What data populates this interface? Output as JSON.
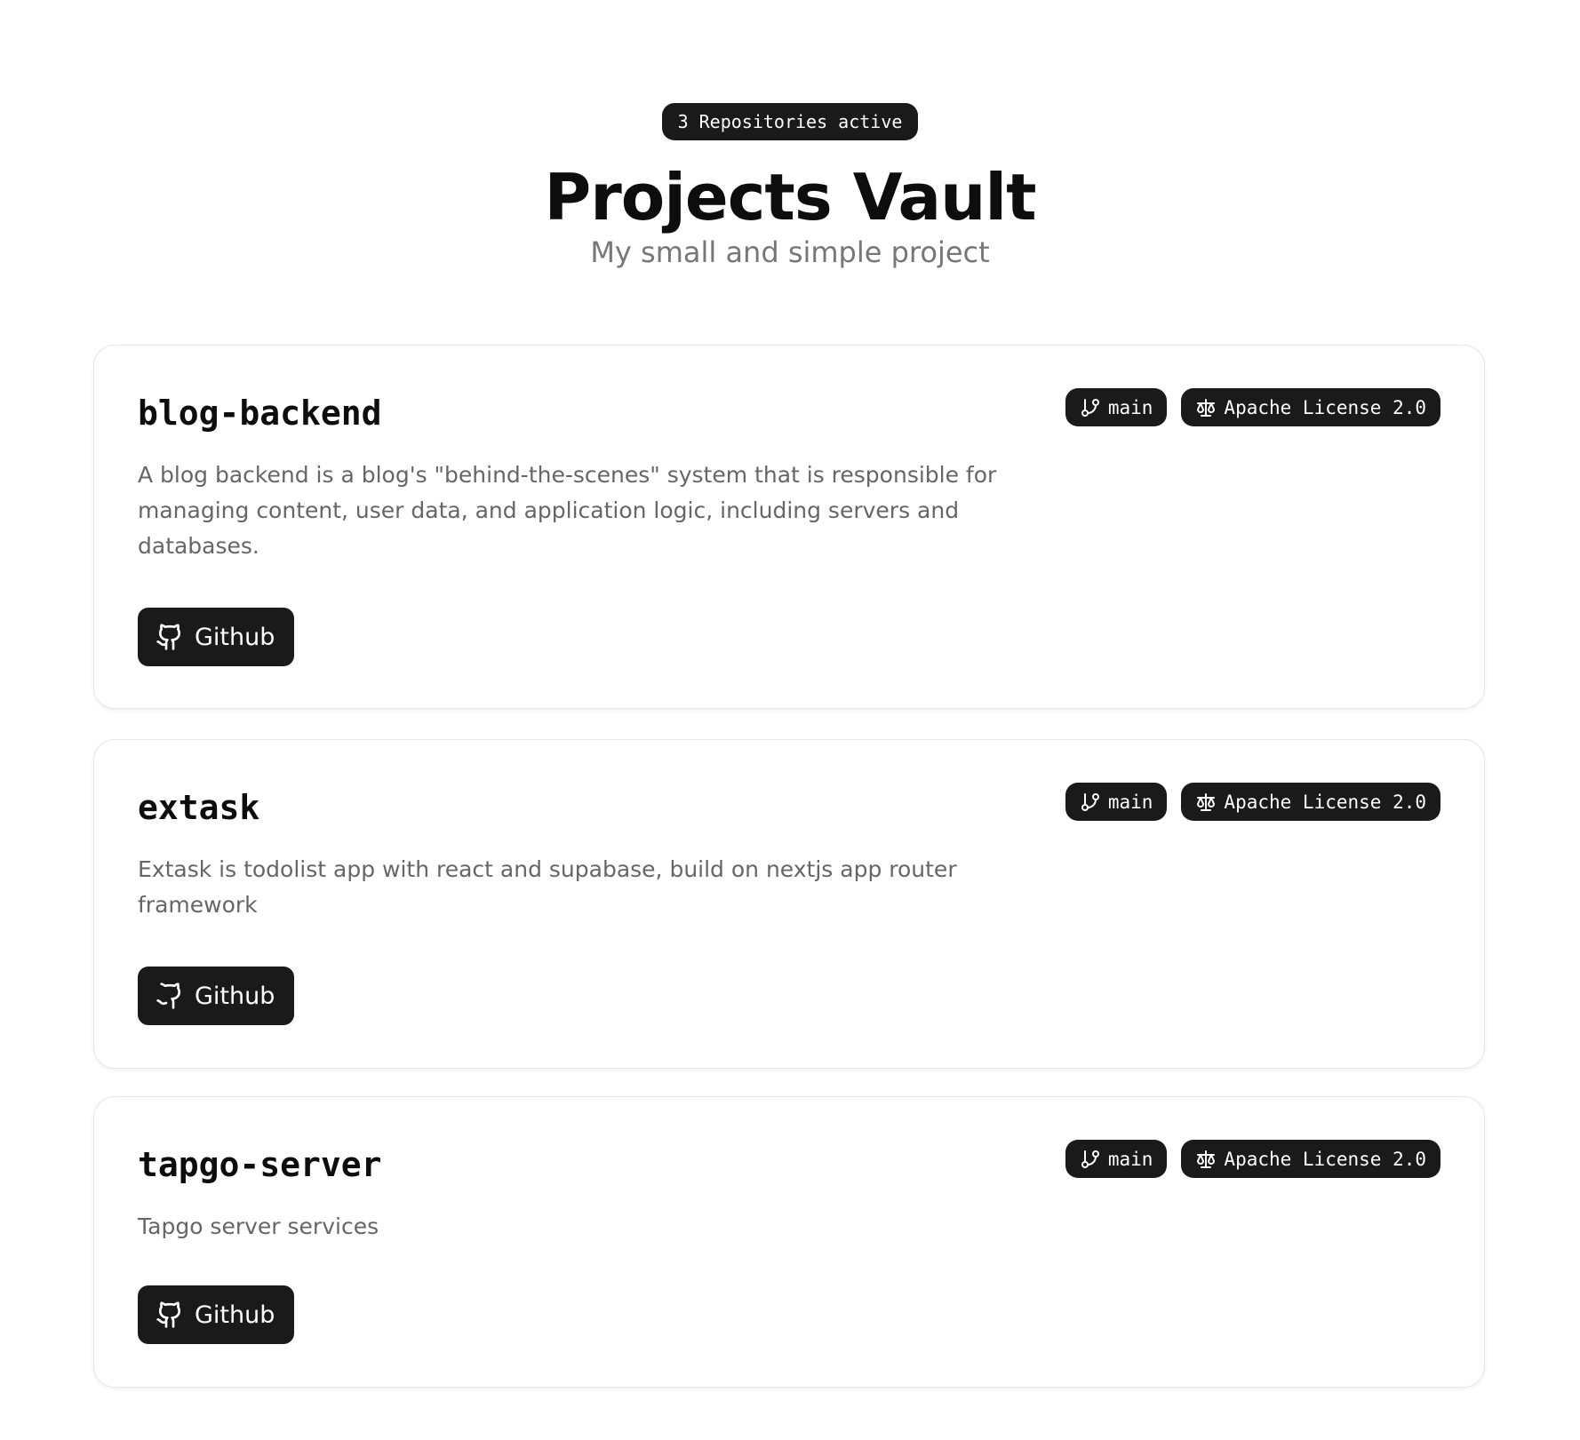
{
  "header": {
    "badge": "3 Repositories active",
    "title": "Projects Vault",
    "subtitle": "My small and simple project"
  },
  "projects": [
    {
      "name": "blog-backend",
      "branch": "main",
      "license": "Apache License 2.0",
      "description": "A blog backend is a blog's \"behind-the-scenes\" system that is responsible for managing content, user data, and application logic, including servers and databases.",
      "button_label": "Github"
    },
    {
      "name": "extask",
      "branch": "main",
      "license": "Apache License 2.0",
      "description": "Extask is todolist app with react and supabase, build on nextjs app router framework",
      "button_label": "Github"
    },
    {
      "name": "tapgo-server",
      "branch": "main",
      "license": "Apache License 2.0",
      "description": "Tapgo server services",
      "button_label": "Github"
    }
  ],
  "icons": {
    "branch": "git-branch-icon",
    "license": "scale-icon",
    "github": "github-icon"
  },
  "colors": {
    "accent": "#1a1a1a",
    "text": "#0d0d0d",
    "muted": "#666666",
    "border": "#e6e6e6"
  }
}
